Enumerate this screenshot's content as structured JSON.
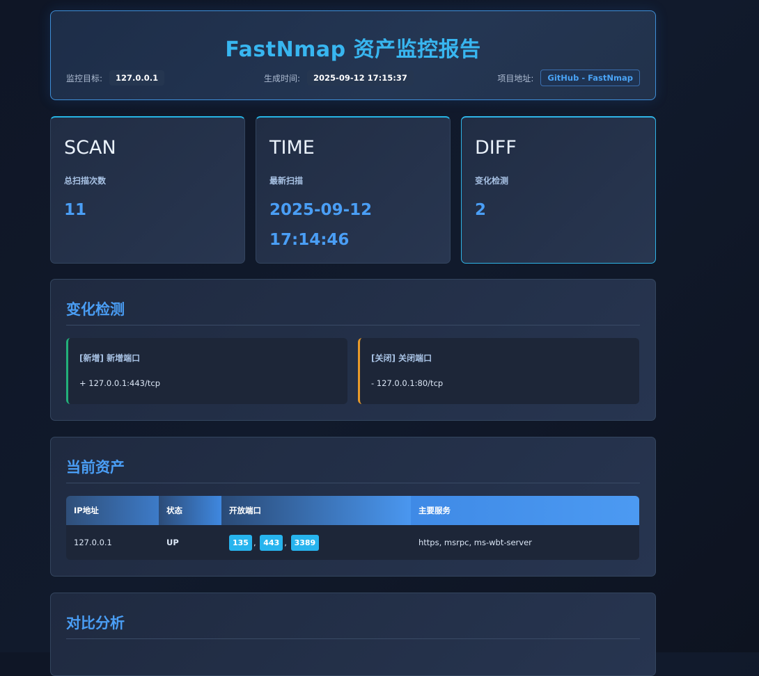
{
  "header": {
    "title": "FastNmap 资产监控报告",
    "target_label": "监控目标:",
    "target_value": "127.0.0.1",
    "time_label": "生成时间:",
    "time_value": "2025-09-12 17:15:37",
    "project_label": "项目地址:",
    "project_link": "GitHub - FastNmap"
  },
  "cards": [
    {
      "title": "SCAN",
      "label": "总扫描次数",
      "value": "11"
    },
    {
      "title": "TIME",
      "label": "最新扫描",
      "value_line1": "2025-09-12",
      "value_line2": "17:14:46"
    },
    {
      "title": "DIFF",
      "label": "变化检测",
      "value": "2"
    }
  ],
  "changes": {
    "title": "变化检测",
    "added": {
      "title": "[新增] 新增端口",
      "detail": "+ 127.0.0.1:443/tcp"
    },
    "closed": {
      "title": "[关闭] 关闭端口",
      "detail": "- 127.0.0.1:80/tcp"
    }
  },
  "assets": {
    "title": "当前资产",
    "columns": [
      "IP地址",
      "状态",
      "开放端口",
      "主要服务"
    ],
    "rows": [
      {
        "ip": "127.0.0.1",
        "status": "UP",
        "ports": [
          "135",
          "443",
          "3389"
        ],
        "services": "https, msrpc, ms-wbt-server"
      }
    ]
  },
  "compare": {
    "title": "对比分析"
  },
  "colors": {
    "accent": "#4a9ef5",
    "title": "#38b6f0",
    "added": "#22b07a",
    "closed": "#e89a2a",
    "port_badge": "#27b4ee"
  }
}
